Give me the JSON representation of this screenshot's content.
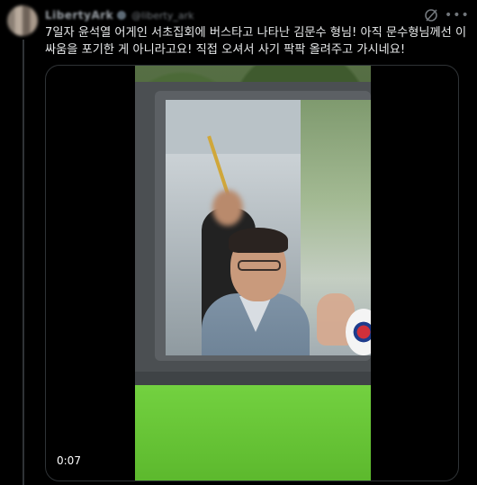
{
  "tweet": {
    "display_name": "LibertyArk",
    "handle": "@liberty_ark",
    "text": "7일자 윤석열 어게인 서초집회에 버스타고 나타난 김문수 형님! 아직 문수형님께선 이 싸움을 포기한 게 아니라고요! 직접 오셔서 사기 팍팍 올려주고 가시네요!"
  },
  "media": {
    "type": "video",
    "timestamp": "0:07"
  },
  "icons": {
    "grok": "grok-icon",
    "more": "more-icon"
  },
  "colors": {
    "background": "#000000",
    "text": "#e7e9ea",
    "secondary": "#71767b",
    "border": "#2f3336"
  }
}
